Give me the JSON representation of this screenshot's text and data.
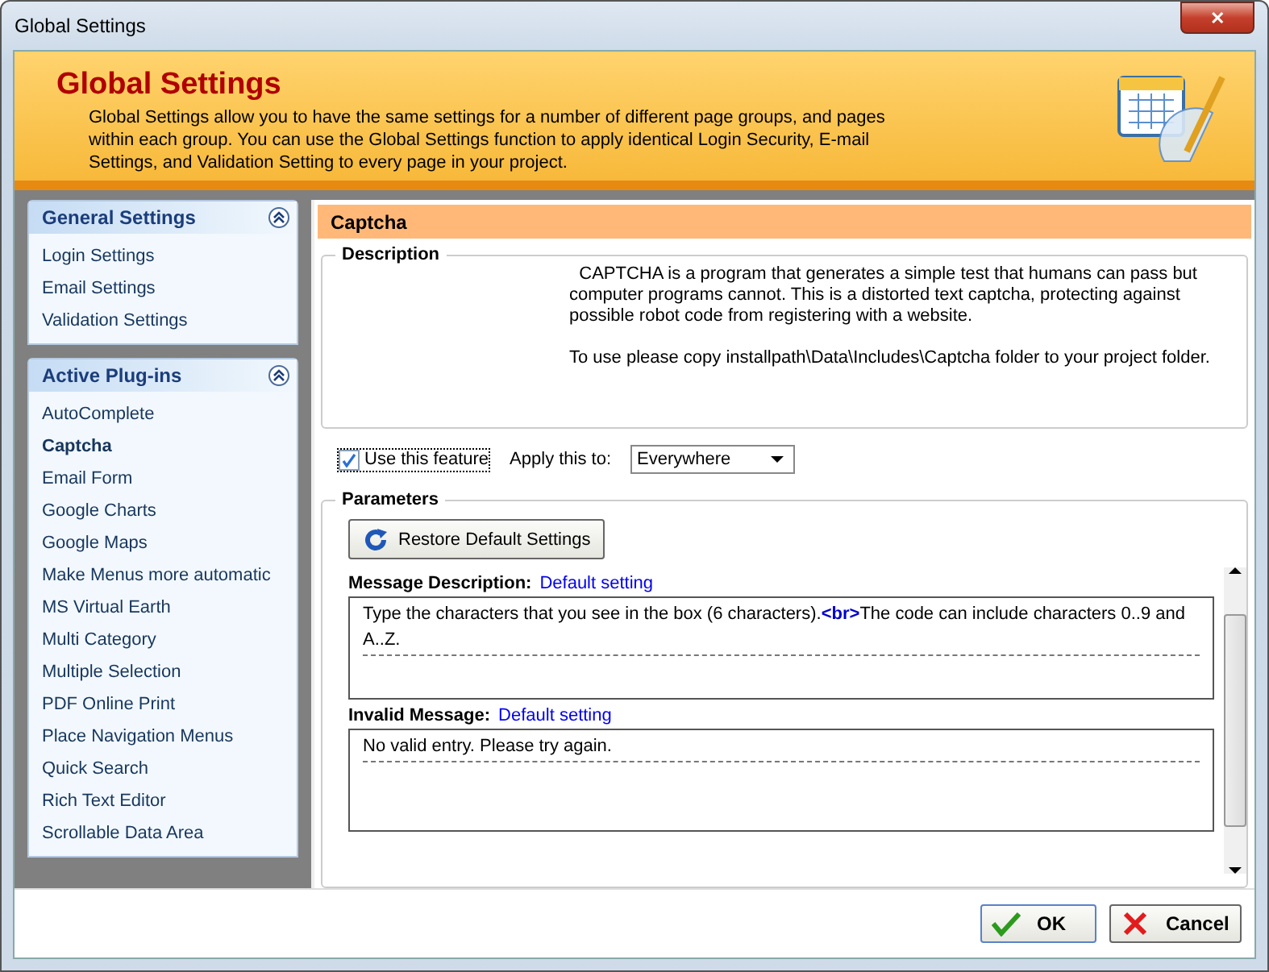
{
  "window": {
    "title": "Global Settings",
    "close": "✕"
  },
  "header": {
    "title": "Global Settings",
    "description": "Global Settings allow you to have the same settings for a number of different page groups, and pages within each group.  You can use the Global Settings function to apply identical Login Security, E-mail Settings, and Validation Setting to every page in your project."
  },
  "sidebar": [
    {
      "title": "General Settings",
      "expanded": true,
      "items": [
        {
          "label": "Login Settings",
          "selected": false
        },
        {
          "label": "Email Settings",
          "selected": false
        },
        {
          "label": "Validation Settings",
          "selected": false
        }
      ]
    },
    {
      "title": "Active Plug-ins",
      "expanded": true,
      "items": [
        {
          "label": "AutoComplete",
          "selected": false
        },
        {
          "label": "Captcha",
          "selected": true
        },
        {
          "label": "Email Form",
          "selected": false
        },
        {
          "label": "Google Charts",
          "selected": false
        },
        {
          "label": "Google Maps",
          "selected": false
        },
        {
          "label": "Make Menus more automatic",
          "selected": false
        },
        {
          "label": "MS Virtual Earth",
          "selected": false
        },
        {
          "label": "Multi Category",
          "selected": false
        },
        {
          "label": "Multiple Selection",
          "selected": false
        },
        {
          "label": "PDF Online Print",
          "selected": false
        },
        {
          "label": "Place Navigation Menus",
          "selected": false
        },
        {
          "label": "Quick Search",
          "selected": false
        },
        {
          "label": "Rich Text Editor",
          "selected": false
        },
        {
          "label": "Scrollable Data Area",
          "selected": false
        }
      ]
    }
  ],
  "panel": {
    "title": "Captcha",
    "description": {
      "legend": "Description",
      "paragraphs": [
        "  CAPTCHA is a program that generates a simple test that humans can pass but computer programs cannot. This is a distorted text captcha, protecting against possible robot code from registering with a website.",
        "To use please copy installpath\\Data\\Includes\\Captcha folder to your project folder."
      ]
    },
    "use_feature": {
      "label": "Use this feature",
      "checked": true
    },
    "apply_to": {
      "label": "Apply this to:",
      "value": "Everywhere"
    },
    "parameters": {
      "legend": "Parameters",
      "restore_button": "Restore Default Settings",
      "fields": [
        {
          "label": "Message Description:",
          "link": "Default setting",
          "segments": [
            {
              "kind": "plain",
              "text": "Type the characters that you see in the box (6 characters)."
            },
            {
              "kind": "tag",
              "text": "<br>"
            },
            {
              "kind": "plain",
              "text": "The code can include characters 0..9 and A..Z."
            }
          ]
        },
        {
          "label": "Invalid Message:",
          "link": "Default setting",
          "segments": [
            {
              "kind": "plain",
              "text": "No valid entry. Please try again."
            }
          ]
        }
      ]
    }
  },
  "buttons": [
    {
      "label": "OK",
      "kind": "ok"
    },
    {
      "label": "Cancel",
      "kind": "cancel"
    }
  ]
}
